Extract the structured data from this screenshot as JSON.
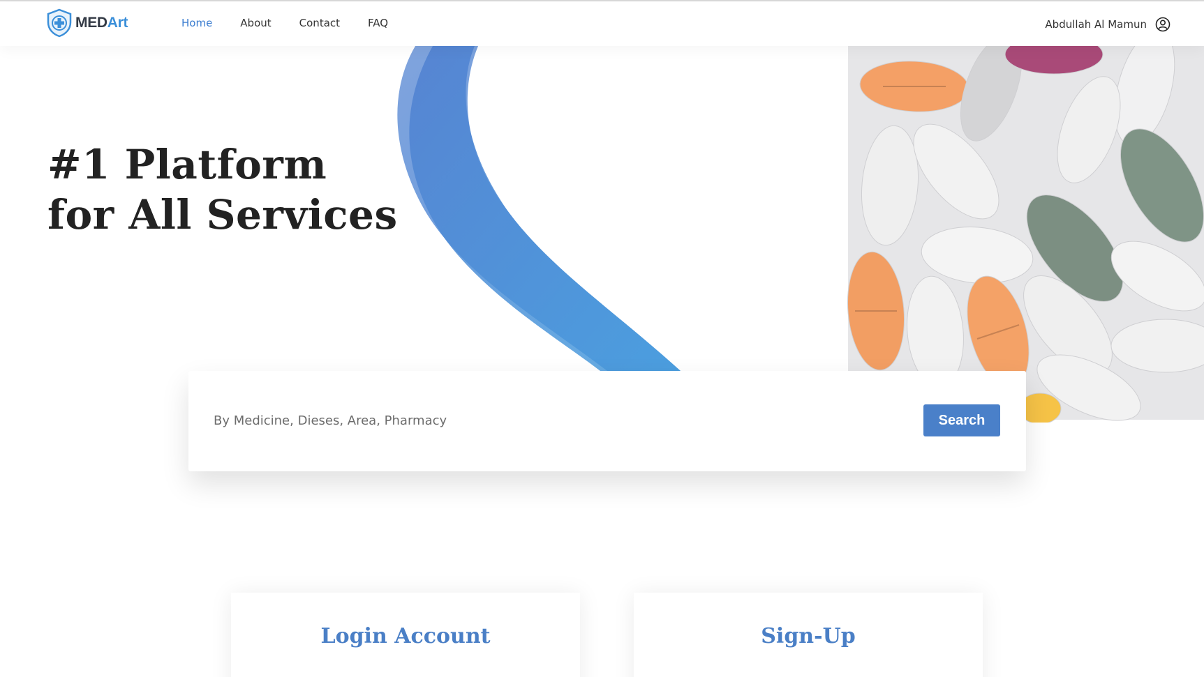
{
  "brand": {
    "name_part1": "MED",
    "name_part2": "Art"
  },
  "nav": {
    "items": [
      {
        "label": "Home",
        "active": true
      },
      {
        "label": "About",
        "active": false
      },
      {
        "label": "Contact",
        "active": false
      },
      {
        "label": "FAQ",
        "active": false
      }
    ]
  },
  "user": {
    "name": "Abdullah Al Mamun",
    "icon": "user-circle-icon"
  },
  "hero": {
    "title_line1": "#1 Platform",
    "title_line2": "for All Services"
  },
  "search": {
    "placeholder": "By Medicine, Dieses, Area, Pharmacy",
    "value": "",
    "button_label": "Search"
  },
  "cards": {
    "login_title": "Login Account",
    "signup_title": "Sign-Up"
  },
  "colors": {
    "accent": "#4a80c9",
    "brand_blue": "#3b8fd9",
    "pill_orange": "#f5a26a",
    "pill_green": "#7f9486"
  }
}
